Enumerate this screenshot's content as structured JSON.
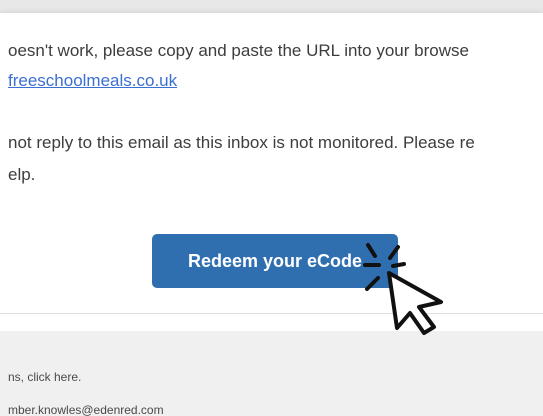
{
  "email": {
    "line1": "oesn't work, please copy and paste the URL into your browse",
    "line2_link": "freeschoolmeals.co.uk",
    "line3": "not reply to this email as this inbox is not monitored. Please re",
    "line4": "elp.",
    "cta_label": "Redeem your eCode"
  },
  "footer": {
    "line1": "ns, click here.",
    "line2": "mber.knowles@edenred.com"
  },
  "colors": {
    "button": "#2f6fb0",
    "link": "#3b6fd1",
    "footer_bg": "#f0f0f0"
  },
  "icons": {
    "cursor": "click-cursor-icon"
  }
}
